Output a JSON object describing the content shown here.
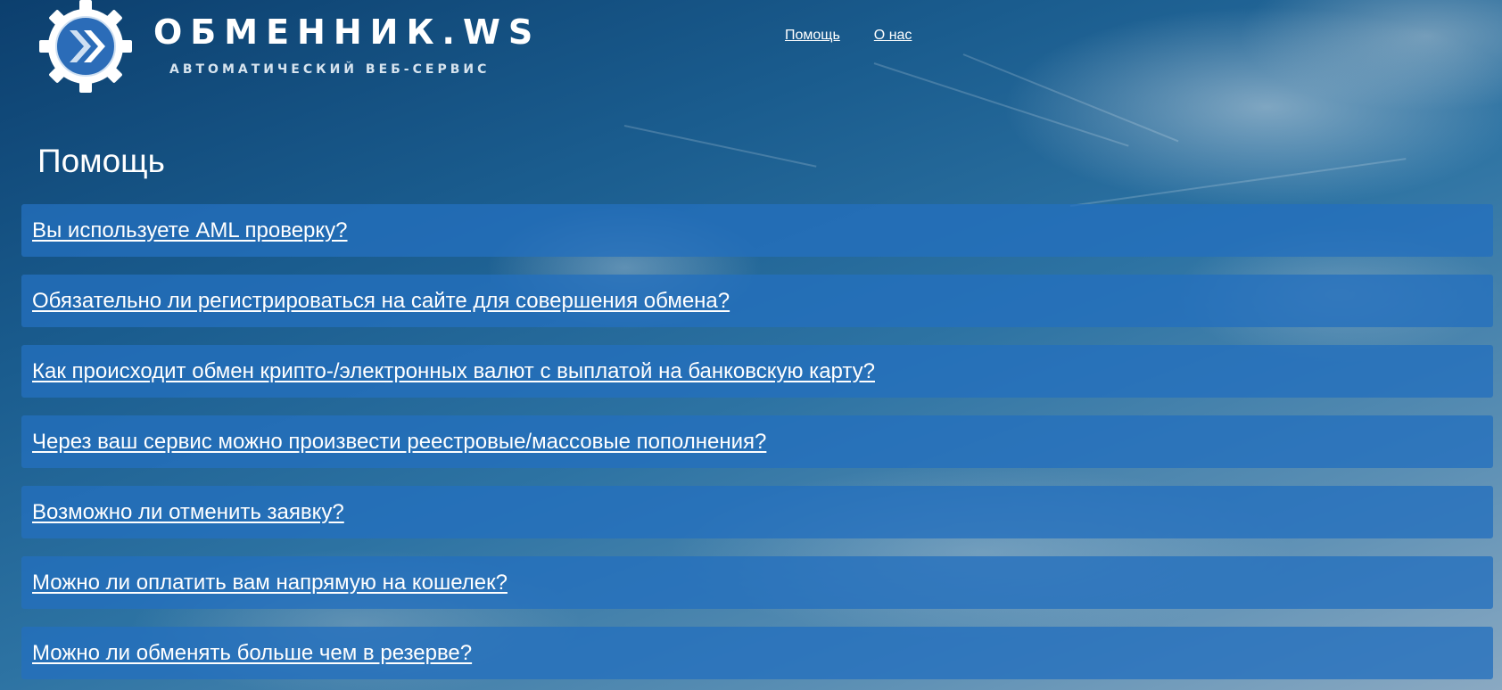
{
  "header": {
    "logo_title": "ОБМЕННИК.WS",
    "logo_subtitle": "АВТОМАТИЧЕСКИЙ ВЕБ-СЕРВИС",
    "nav": [
      {
        "label": "Помощь"
      },
      {
        "label": "О нас"
      }
    ]
  },
  "main": {
    "title": "Помощь",
    "faq": [
      {
        "question": "Вы используете AML проверку?"
      },
      {
        "question": "Обязательно ли регистрироваться на сайте для совершения обмена?"
      },
      {
        "question": "Как происходит обмен крипто-/электронных валют с выплатой на банковскую карту?"
      },
      {
        "question": "Через ваш сервис можно произвести реестровые/массовые пополнения?"
      },
      {
        "question": "Возможно ли отменить заявку?"
      },
      {
        "question": "Можно ли оплатить вам напрямую на кошелек?"
      },
      {
        "question": "Можно ли обменять больше чем в резерве?"
      }
    ]
  },
  "colors": {
    "faq_background": "#2470be",
    "logo_gear": "#ffffff",
    "logo_inner": "#2b6cb8",
    "text": "#ffffff"
  },
  "icons": {
    "logo": "gear-chevron-logo-icon"
  }
}
